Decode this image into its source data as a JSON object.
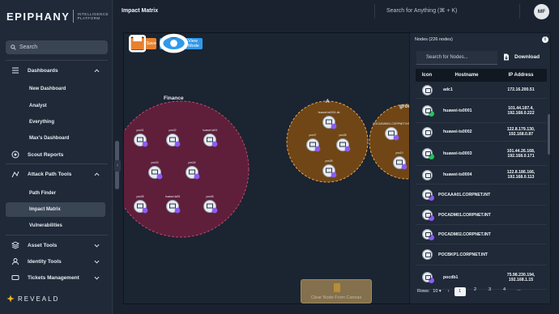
{
  "brand": {
    "name": "EPIPHANY",
    "subtitle": "INTELLIGENCE PLATFORM",
    "footer": "REVEALD"
  },
  "sidebar": {
    "search_placeholder": "Search",
    "items": [
      {
        "label": "Dashboards",
        "icon": "dashboard-icon",
        "expanded": true
      },
      {
        "label": "New Dashboard"
      },
      {
        "label": "Analyst"
      },
      {
        "label": "Everything"
      },
      {
        "label": "Max's Dashboard"
      },
      {
        "label": "Scout Reports",
        "icon": "scout-icon"
      },
      {
        "label": "Attack Path Tools",
        "icon": "attack-path-icon",
        "expanded": true
      },
      {
        "label": "Path Finder"
      },
      {
        "label": "Impact Matrix",
        "active": true
      },
      {
        "label": "Vulnerabilities"
      },
      {
        "label": "Asset Tools",
        "icon": "asset-tools-icon"
      },
      {
        "label": "Identity Tools",
        "icon": "identity-tools-icon"
      },
      {
        "label": "Tickets Management",
        "icon": "tickets-icon"
      }
    ]
  },
  "header": {
    "title": "Impact Matrix",
    "search_placeholder": "Search for Anything (⌘ + K)",
    "avatar_initials": "MF"
  },
  "toolbar": {
    "save_label": "Save",
    "view_mode_label": "View Mode"
  },
  "clusters": [
    {
      "label": "Finance",
      "color": "#6b1f3c"
    },
    {
      "label": "A",
      "color": "#7a4a14"
    },
    {
      "label": "grou",
      "color": "#7a4a14"
    }
  ],
  "finance_nodes": [
    "pcs01",
    "pcs02",
    "huawei-ts04",
    "pcs03",
    "pcs04",
    "pcs05",
    "huawei-ts05",
    "pcs06"
  ],
  "a_nodes": [
    "huawei-ts0001-tst",
    "pcs07",
    "pcs08",
    "pcs09"
  ],
  "grou_nodes": [
    "POCADMIN01.CORPNET.INT",
    "pcs10",
    "pcs11"
  ],
  "clear_node_label": "Clear Node From Canvas",
  "nodes_panel": {
    "title": "Nodes (226 nodes)",
    "search_placeholder": "Search for Nodes...",
    "download_label": "Download",
    "columns": [
      "Icon",
      "Hostname",
      "IP Address"
    ],
    "rows": [
      {
        "hostname": "adc1",
        "ip": "172.16.200.51",
        "badge": ""
      },
      {
        "hostname": "huawei-ts0001",
        "ip": "101.44.187.4, 192.168.0.222",
        "badge": "#22c55e"
      },
      {
        "hostname": "huawei-ts0002",
        "ip": "122.8.179.130, 192.168.0.87",
        "badge": ""
      },
      {
        "hostname": "huawei-ts0003",
        "ip": "101.44.26.168, 192.168.0.171",
        "badge": "#22c55e"
      },
      {
        "hostname": "huawei-ts0004",
        "ip": "122.8.186.166, 192.168.0.113",
        "badge": ""
      },
      {
        "hostname": "POCAAA01.CORPNET.INT",
        "ip": "",
        "badge": "#8b5cf6"
      },
      {
        "hostname": "POCADM01.CORPNET.INT",
        "ip": "",
        "badge": "#8b5cf6"
      },
      {
        "hostname": "POCADM02.CORPNET.INT",
        "ip": "",
        "badge": "#8b5cf6"
      },
      {
        "hostname": "POCBKP1.CORPNET.INT",
        "ip": "",
        "badge": ""
      },
      {
        "hostname": "pocdb1",
        "ip": "75.98.230.194, 192.168.1.15",
        "badge": "#8b5cf6"
      }
    ],
    "pager": {
      "rows_label": "Rows:",
      "rows_value": "10",
      "pages": [
        "1",
        "2",
        "3",
        "4",
        "..."
      ]
    }
  }
}
